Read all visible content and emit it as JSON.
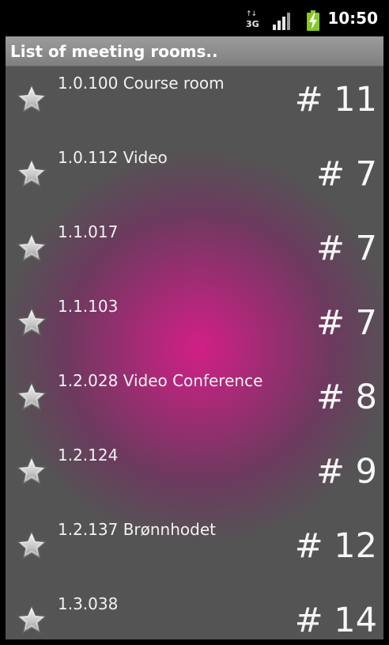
{
  "status_bar": {
    "network_label": "3G",
    "network_activity": "↑↓",
    "time": "10:50",
    "icons": [
      "data-3g-icon",
      "signal-strength-icon",
      "battery-charging-icon"
    ],
    "battery_color": "#86c828"
  },
  "title_bar": {
    "title": "List of meeting rooms.."
  },
  "rooms": [
    {
      "name": "1.0.100 Course room",
      "count": "# 11",
      "icon": "star-icon"
    },
    {
      "name": "1.0.112 Video",
      "count": "# 7",
      "icon": "star-icon"
    },
    {
      "name": "1.1.017",
      "count": "# 7",
      "icon": "star-icon"
    },
    {
      "name": "1.1.103",
      "count": "# 7",
      "icon": "star-icon"
    },
    {
      "name": "1.2.028 Video Conference",
      "count": "# 8",
      "icon": "star-icon"
    },
    {
      "name": "1.2.124",
      "count": "# 9",
      "icon": "star-icon"
    },
    {
      "name": "1.2.137 Brønnhodet",
      "count": "# 12",
      "icon": "star-icon"
    },
    {
      "name": "1.3.038",
      "count": "# 14",
      "icon": "star-icon"
    }
  ],
  "colors": {
    "list_background": "#545454",
    "highlight_center": "#d21f87",
    "title_bar": "#8d8d8d"
  }
}
